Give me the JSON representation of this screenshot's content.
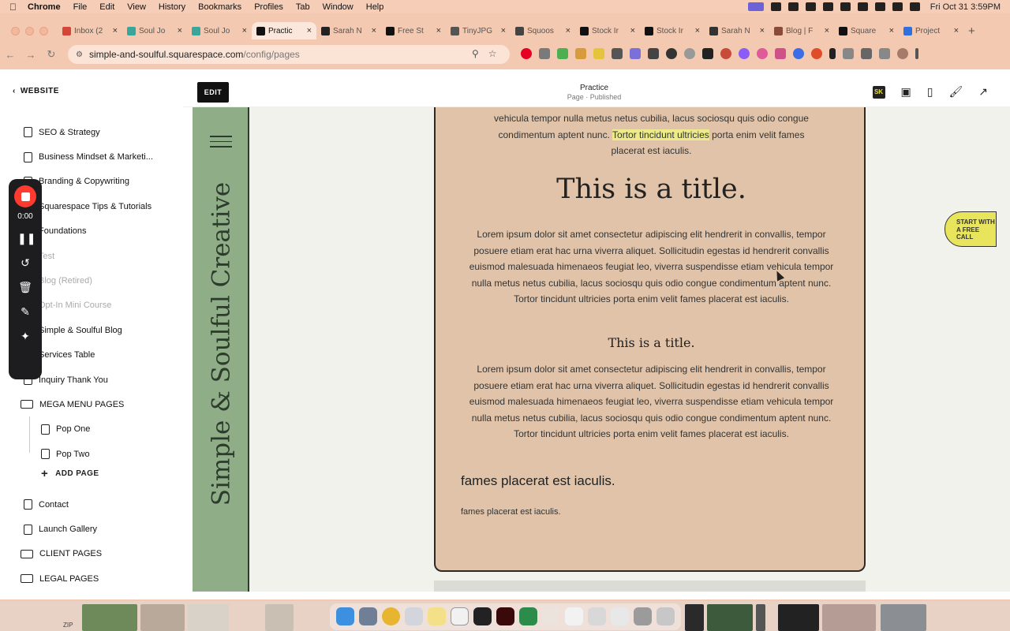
{
  "menubar": {
    "app": "Chrome",
    "items": [
      "File",
      "Edit",
      "View",
      "History",
      "Bookmarks",
      "Profiles",
      "Tab",
      "Window",
      "Help"
    ],
    "clock": "Fri Oct 31  3:59PM"
  },
  "tabs": [
    {
      "label": "Inbox (2",
      "color": "#d44638"
    },
    {
      "label": "Soul Jo",
      "color": "#3aa59a"
    },
    {
      "label": "Soul Jo",
      "color": "#3aa59a"
    },
    {
      "label": "Practic",
      "color": "#111111",
      "active": true
    },
    {
      "label": "Sarah N",
      "color": "#222222"
    },
    {
      "label": "Free St",
      "color": "#111111"
    },
    {
      "label": "TinyJPG",
      "color": "#555555"
    },
    {
      "label": "Squoos",
      "color": "#444444"
    },
    {
      "label": "Stock Ir",
      "color": "#111111"
    },
    {
      "label": "Stock Ir",
      "color": "#111111"
    },
    {
      "label": "Sarah N",
      "color": "#333333"
    },
    {
      "label": "Blog | F",
      "color": "#8a4a3c"
    },
    {
      "label": "Square",
      "color": "#111111"
    },
    {
      "label": "Project",
      "color": "#2f6fde"
    }
  ],
  "address": {
    "host": "simple-and-soulful.squarespace.com",
    "path": "/config/pages"
  },
  "sidebar": {
    "back_label": "WEBSITE",
    "items": [
      {
        "label": "SEO & Strategy",
        "kind": "page"
      },
      {
        "label": "Business Mindset & Marketi...",
        "kind": "page"
      },
      {
        "label": "Branding & Copywriting",
        "kind": "page"
      },
      {
        "label": "Squarespace Tips & Tutorials",
        "kind": "page"
      },
      {
        "label": "Foundations",
        "kind": "page"
      },
      {
        "label": "Test",
        "kind": "page",
        "muted": true
      },
      {
        "label": "Blog (Retired)",
        "kind": "page",
        "muted": true
      },
      {
        "label": "Opt-In Mini Course",
        "kind": "page",
        "muted": true
      },
      {
        "label": "Simple & Soulful Blog",
        "kind": "page"
      },
      {
        "label": "Services Table",
        "kind": "page"
      },
      {
        "label": "Inquiry Thank You",
        "kind": "page"
      },
      {
        "label": "MEGA MENU PAGES",
        "kind": "folder"
      },
      {
        "label": "Pop One",
        "kind": "sub"
      },
      {
        "label": "Pop Two",
        "kind": "sub"
      }
    ],
    "add_page_label": "ADD PAGE",
    "items_after": [
      {
        "label": "Contact",
        "kind": "page"
      },
      {
        "label": "Launch Gallery",
        "kind": "page"
      },
      {
        "label": "CLIENT PAGES",
        "kind": "folder"
      },
      {
        "label": "LEGAL PAGES",
        "kind": "folder"
      }
    ]
  },
  "recorder": {
    "time": "0:00"
  },
  "editor": {
    "edit_label": "EDIT",
    "page_title": "Practice",
    "page_status": "Page · Published",
    "badge": "SK"
  },
  "site": {
    "brand": "Simple & Soulful Creative",
    "para_top_1": "vehicula tempor nulla metus netus cubilia, lacus sociosqu quis odio congue",
    "para_top_2a": "condimentum aptent nunc. ",
    "para_top_highlight": "Tortor tincidunt ultricies",
    "para_top_2b": " porta enim velit fames",
    "para_top_3": "placerat est iaculis.",
    "title_large": "This is a title.",
    "para_body": "Lorem ipsum dolor sit amet consectetur adipiscing elit hendrerit in convallis, tempor posuere etiam erat hac urna viverra aliquet. Sollicitudin egestas id hendrerit convallis euismod malesuada himenaeos feugiat leo, viverra suspendisse etiam vehicula tempor nulla metus netus cubilia, lacus sociosqu quis odio congue condimentum aptent nunc. Tortor tincidunt ultricies porta enim velit fames placerat est iaculis.",
    "title_small": "This is a title.",
    "heading_left": "fames placerat est iaculis.",
    "small_left": "fames placerat est iaculis.",
    "cta": "START WITH A FREE CALL"
  },
  "dock": {
    "zip_label": "ZIP"
  },
  "colors": {
    "rail": "#8fae87",
    "card": "#e0c3a8",
    "highlight": "#ecea8a",
    "cta": "#e8e45c",
    "record": "#ff3b30"
  }
}
